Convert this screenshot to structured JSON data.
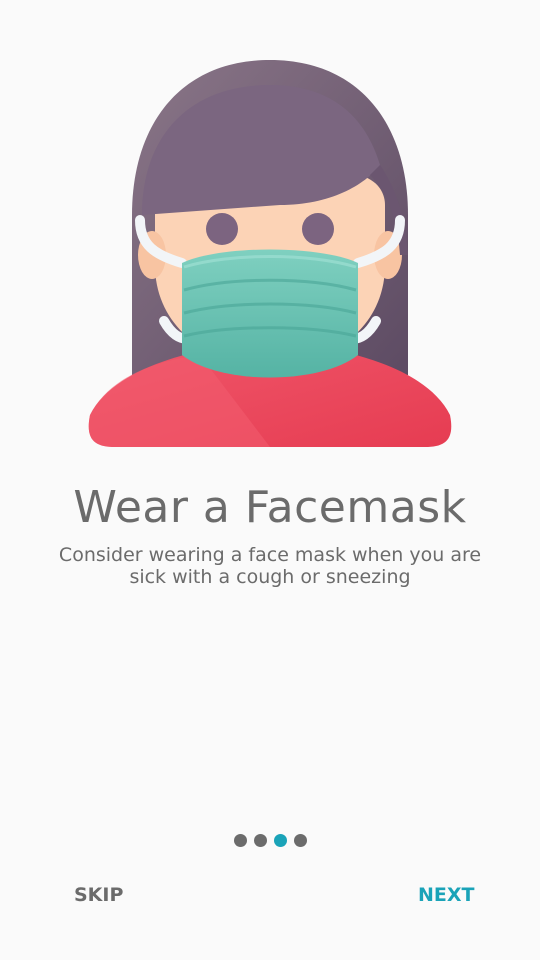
{
  "onboarding": {
    "title": "Wear a Facemask",
    "description": "Consider wearing a face mask when you are sick with a cough or sneezing",
    "page_indicator": {
      "total_pages": 4,
      "current_page": 3
    },
    "skip_label": "SKIP",
    "next_label": "NEXT"
  },
  "colors": {
    "background": "#fafafa",
    "text": "#6b6b6b",
    "accent": "#1aa3b8",
    "hair": "#6e5a74",
    "skin": "#fcd3b6",
    "mask": "#6cc4b4",
    "shirt": "#ec4b5e"
  },
  "illustration": {
    "icon": "woman-wearing-facemask-icon"
  }
}
